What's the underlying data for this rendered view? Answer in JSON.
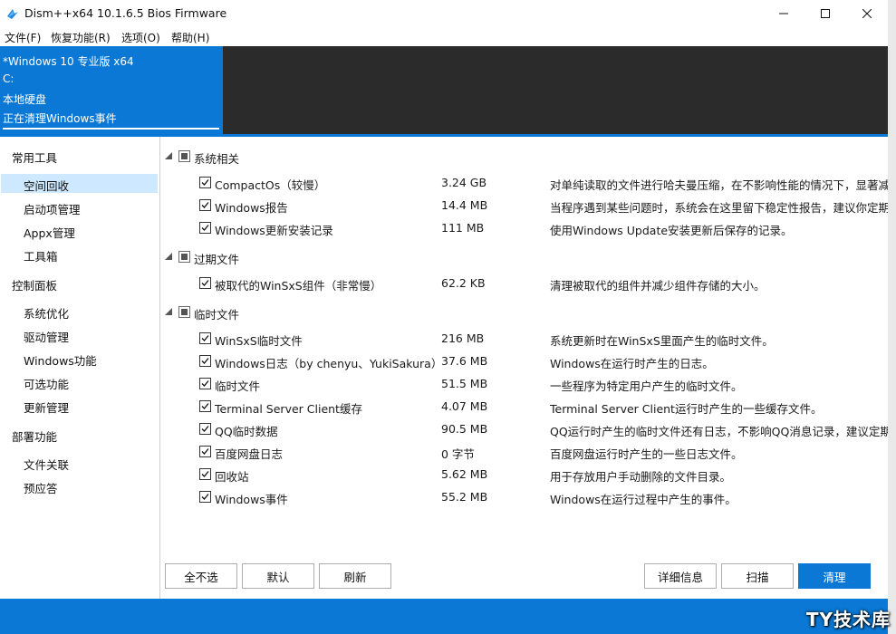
{
  "window": {
    "title": "Dism++x64 10.1.6.5 Bios Firmware"
  },
  "menu": [
    {
      "label": "文件(F)"
    },
    {
      "label": "恢复功能(R)"
    },
    {
      "label": "选项(O)"
    },
    {
      "label": "帮助(H)"
    }
  ],
  "session": {
    "os": "*Windows 10 专业版 x64",
    "drive": "C:",
    "disk": "本地硬盘",
    "status": "正在清理Windows事件"
  },
  "sidebar": {
    "groups": [
      {
        "label": "常用工具",
        "items": [
          "空间回收",
          "启动项管理",
          "Appx管理",
          "工具箱"
        ]
      },
      {
        "label": "控制面板",
        "items": [
          "系统优化",
          "驱动管理",
          "Windows功能",
          "可选功能",
          "更新管理"
        ]
      },
      {
        "label": "部署功能",
        "items": [
          "文件关联",
          "预应答"
        ]
      }
    ],
    "selected": "空间回收"
  },
  "cleanup": {
    "groups": [
      {
        "label": "系统相关",
        "items": [
          {
            "name": "CompactOs（较慢）",
            "size": "3.24 GB",
            "desc": "对单纯读取的文件进行哈夫曼压缩，在不影响性能的情况下，显著减少"
          },
          {
            "name": "Windows报告",
            "size": "14.4 MB",
            "desc": "当程序遇到某些问题时，系统会在这里留下稳定性报告，建议你定期清"
          },
          {
            "name": "Windows更新安装记录",
            "size": "111 MB",
            "desc": "使用Windows Update安装更新后保存的记录。"
          }
        ]
      },
      {
        "label": "过期文件",
        "items": [
          {
            "name": "被取代的WinSxS组件（非常慢）",
            "size": "62.2 KB",
            "desc": "清理被取代的组件并减少组件存储的大小。"
          }
        ]
      },
      {
        "label": "临时文件",
        "items": [
          {
            "name": "WinSxS临时文件",
            "size": "216 MB",
            "desc": "系统更新时在WinSxS里面产生的临时文件。"
          },
          {
            "name": "Windows日志（by chenyu、YukiSakura）",
            "size": "37.6 MB",
            "desc": "Windows在运行时产生的日志。"
          },
          {
            "name": "临时文件",
            "size": "51.5 MB",
            "desc": "一些程序为特定用户产生的临时文件。"
          },
          {
            "name": "Terminal Server Client缓存",
            "size": "4.07 MB",
            "desc": "Terminal Server Client运行时产生的一些缓存文件。"
          },
          {
            "name": "QQ临时数据",
            "size": "90.5 MB",
            "desc": "QQ运行时产生的临时文件还有日志，不影响QQ消息记录，建议定期册"
          },
          {
            "name": "百度网盘日志",
            "size": "0 字节",
            "desc": "百度网盘运行时产生的一些日志文件。"
          },
          {
            "name": "回收站",
            "size": "5.62 MB",
            "desc": "用于存放用户手动删除的文件目录。"
          },
          {
            "name": "Windows事件",
            "size": "55.2 MB",
            "desc": "Windows在运行过程中产生的事件。"
          }
        ]
      }
    ]
  },
  "buttons": {
    "deselect_all": "全不选",
    "default": "默认",
    "refresh": "刷新",
    "details": "详细信息",
    "scan": "扫描",
    "clean": "清理"
  },
  "watermark": "TY技术库",
  "colors": {
    "accent": "#0a78d4",
    "selection": "#cde8ff",
    "dark_panel": "#2b2b2b"
  }
}
